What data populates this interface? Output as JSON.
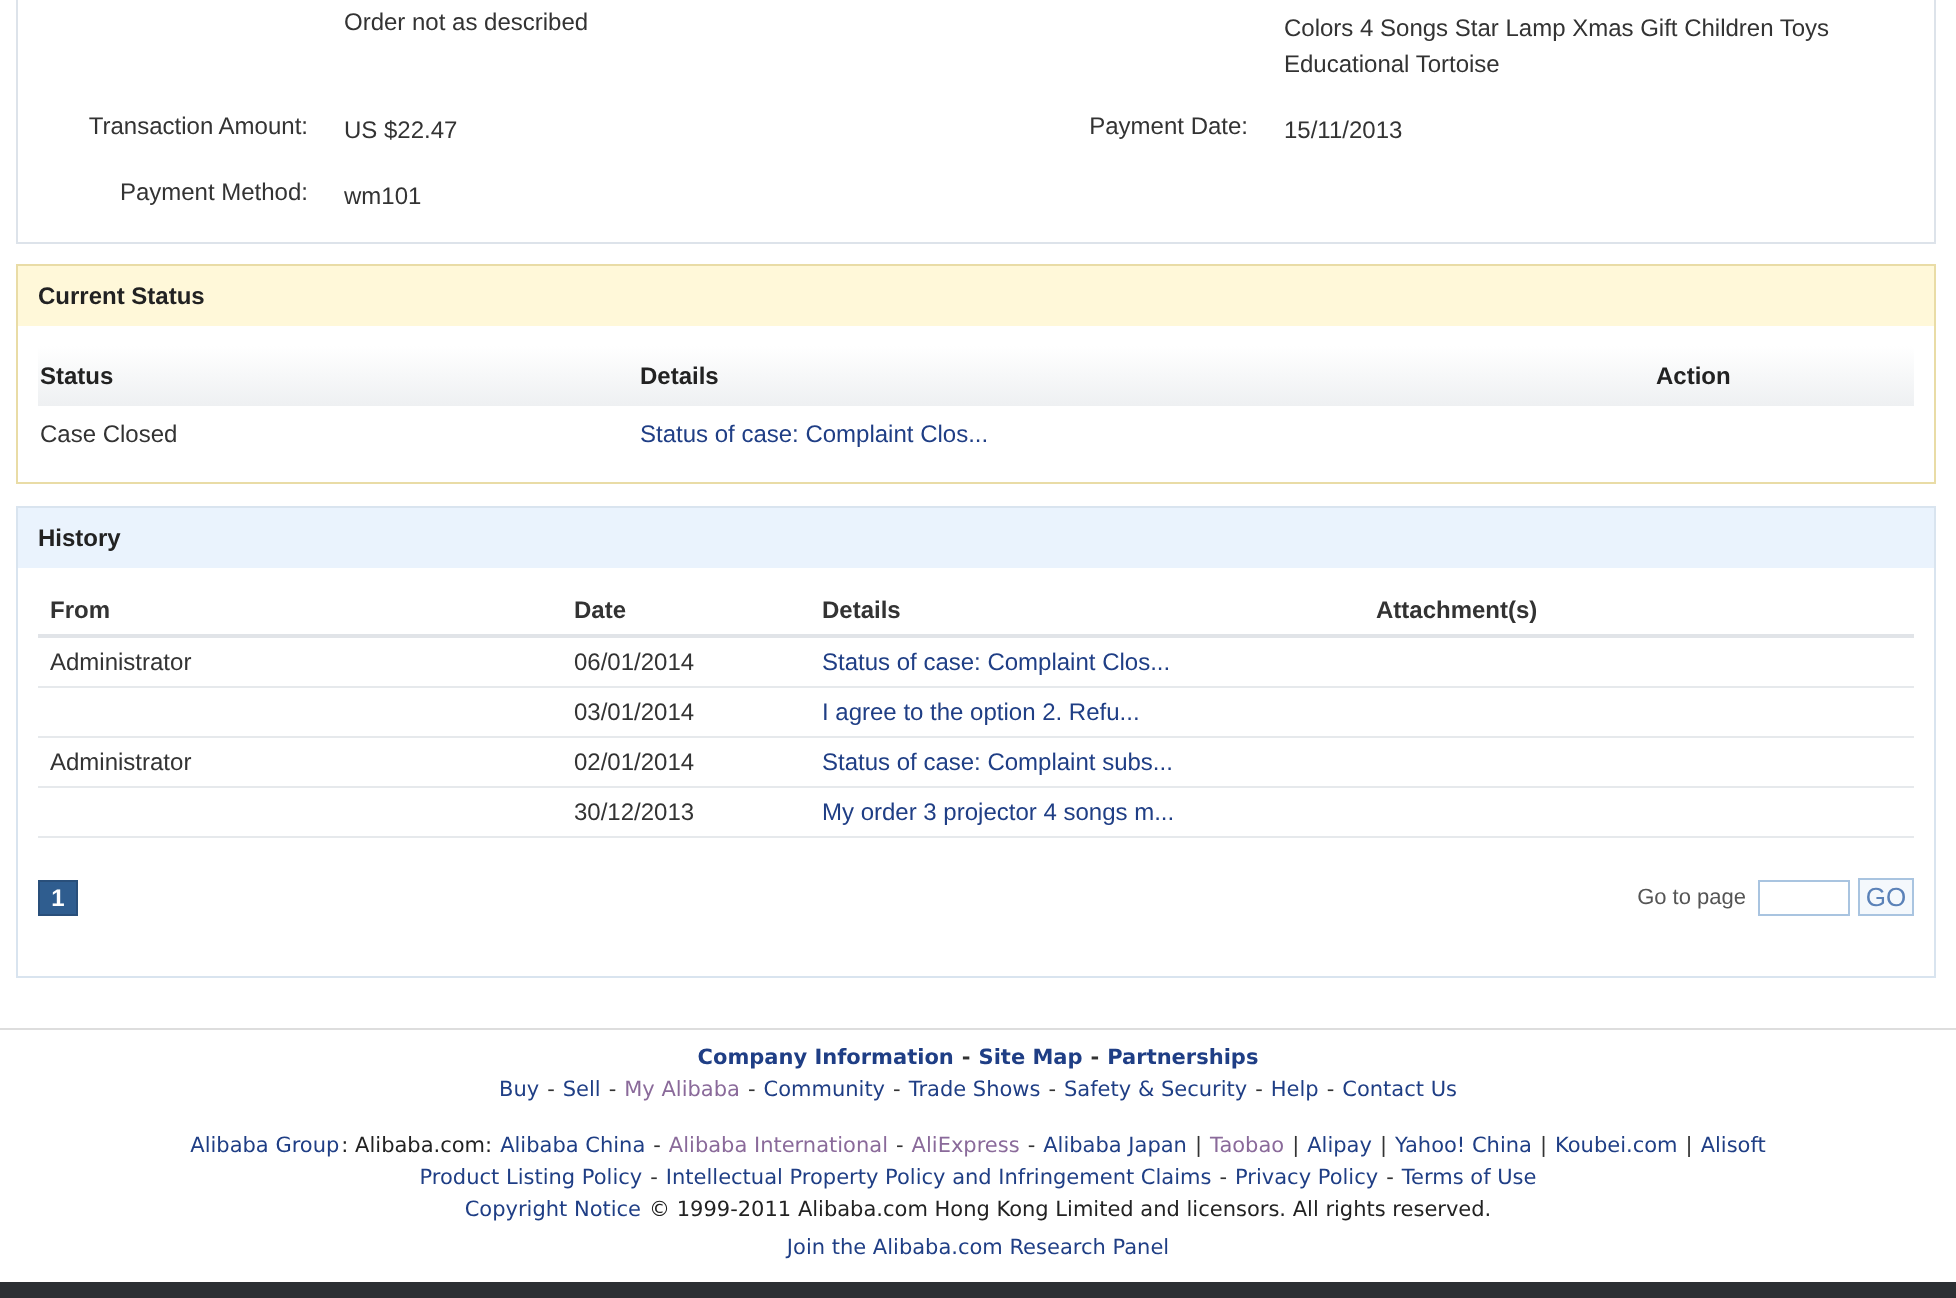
{
  "order_details": {
    "rows": [
      {
        "left": {
          "value": "Order not as described"
        },
        "right": {
          "lines": [
            "Colors 4 Songs Star Lamp Xmas Gift Children Toys",
            "Educational Tortoise"
          ]
        }
      },
      {
        "left": {
          "label": "Transaction Amount:",
          "value": "US $22.47"
        },
        "right": {
          "label": "Payment Date:",
          "lines": [
            "15/11/2013"
          ]
        }
      },
      {
        "left": {
          "label": "Payment Method:",
          "value": "wm101"
        },
        "right": null
      }
    ]
  },
  "current_status": {
    "title": "Current Status",
    "columns": [
      "Status",
      "Details",
      "Action"
    ],
    "rows": [
      {
        "status": "Case Closed",
        "details": "Status of case: Complaint Clos..."
      }
    ]
  },
  "history": {
    "title": "History",
    "columns": [
      "From",
      "Date",
      "Details",
      "Attachment(s)"
    ],
    "rows": [
      {
        "from": "Administrator",
        "date": "06/01/2014",
        "details": "Status of case: Complaint Clos..."
      },
      {
        "from": "",
        "date": "03/01/2014",
        "details": "I agree to the option 2. Refu..."
      },
      {
        "from": "Administrator",
        "date": "02/01/2014",
        "details": "Status of case: Complaint subs..."
      },
      {
        "from": "",
        "date": "30/12/2013",
        "details": "My order 3 projector 4 songs m..."
      }
    ],
    "pages": [
      {
        "label": "1",
        "selected": true
      }
    ],
    "goto_label": "Go to page",
    "go_button": "GO"
  },
  "footer": {
    "lines": [
      {
        "bold": true,
        "items": [
          {
            "kind": "link",
            "text": "Company Information",
            "visited": false
          },
          {
            "kind": "sep",
            "text": "-"
          },
          {
            "kind": "link",
            "text": "Site Map",
            "visited": false
          },
          {
            "kind": "sep",
            "text": "-"
          },
          {
            "kind": "link",
            "text": "Partnerships",
            "visited": false
          }
        ]
      },
      {
        "bold": false,
        "items": [
          {
            "kind": "link",
            "text": "Buy",
            "visited": false
          },
          {
            "kind": "sep",
            "text": "-"
          },
          {
            "kind": "link",
            "text": "Sell",
            "visited": false
          },
          {
            "kind": "sep",
            "text": "-"
          },
          {
            "kind": "link",
            "text": "My Alibaba",
            "visited": true
          },
          {
            "kind": "sep",
            "text": "-"
          },
          {
            "kind": "link",
            "text": "Community",
            "visited": false
          },
          {
            "kind": "sep",
            "text": "-"
          },
          {
            "kind": "link",
            "text": "Trade Shows",
            "visited": false
          },
          {
            "kind": "sep",
            "text": "-"
          },
          {
            "kind": "link",
            "text": "Safety & Security",
            "visited": false
          },
          {
            "kind": "sep",
            "text": "-"
          },
          {
            "kind": "link",
            "text": "Help",
            "visited": false
          },
          {
            "kind": "sep",
            "text": "-"
          },
          {
            "kind": "link",
            "text": "Contact Us",
            "visited": false
          }
        ]
      },
      {
        "bold": false,
        "items": [
          {
            "kind": "link",
            "text": "Alibaba Group",
            "visited": false
          },
          {
            "kind": "text",
            "text": ": Alibaba.com:"
          },
          {
            "kind": "link",
            "text": "Alibaba China",
            "visited": false
          },
          {
            "kind": "sep",
            "text": "-"
          },
          {
            "kind": "link",
            "text": "Alibaba International",
            "visited": true
          },
          {
            "kind": "sep",
            "text": "-"
          },
          {
            "kind": "link",
            "text": "AliExpress",
            "visited": true
          },
          {
            "kind": "sep",
            "text": "-"
          },
          {
            "kind": "link",
            "text": "Alibaba Japan",
            "visited": false
          },
          {
            "kind": "sep",
            "text": "|"
          },
          {
            "kind": "link",
            "text": "Taobao",
            "visited": true
          },
          {
            "kind": "sep",
            "text": "|"
          },
          {
            "kind": "link",
            "text": "Alipay",
            "visited": false
          },
          {
            "kind": "sep",
            "text": "|"
          },
          {
            "kind": "link",
            "text": "Yahoo! China",
            "visited": false
          },
          {
            "kind": "sep",
            "text": "|"
          },
          {
            "kind": "link",
            "text": "Koubei.com",
            "visited": false
          },
          {
            "kind": "sep",
            "text": "|"
          },
          {
            "kind": "link",
            "text": "Alisoft",
            "visited": false
          }
        ]
      },
      {
        "bold": false,
        "items": [
          {
            "kind": "link",
            "text": "Product Listing Policy",
            "visited": false
          },
          {
            "kind": "sep",
            "text": "-"
          },
          {
            "kind": "link",
            "text": "Intellectual Property Policy and Infringement Claims",
            "visited": false
          },
          {
            "kind": "sep",
            "text": "-"
          },
          {
            "kind": "link",
            "text": "Privacy Policy",
            "visited": false
          },
          {
            "kind": "sep",
            "text": "-"
          },
          {
            "kind": "link",
            "text": "Terms of Use",
            "visited": false
          }
        ]
      },
      {
        "bold": false,
        "items": [
          {
            "kind": "link",
            "text": "Copyright Notice",
            "visited": false
          },
          {
            "kind": "text",
            "text": "© 1999-2011 Alibaba.com Hong Kong Limited and licensors. All rights reserved."
          }
        ]
      },
      {
        "bold": false,
        "items": [
          {
            "kind": "link",
            "text": "Join the Alibaba.com Research Panel",
            "visited": false
          }
        ]
      }
    ]
  }
}
